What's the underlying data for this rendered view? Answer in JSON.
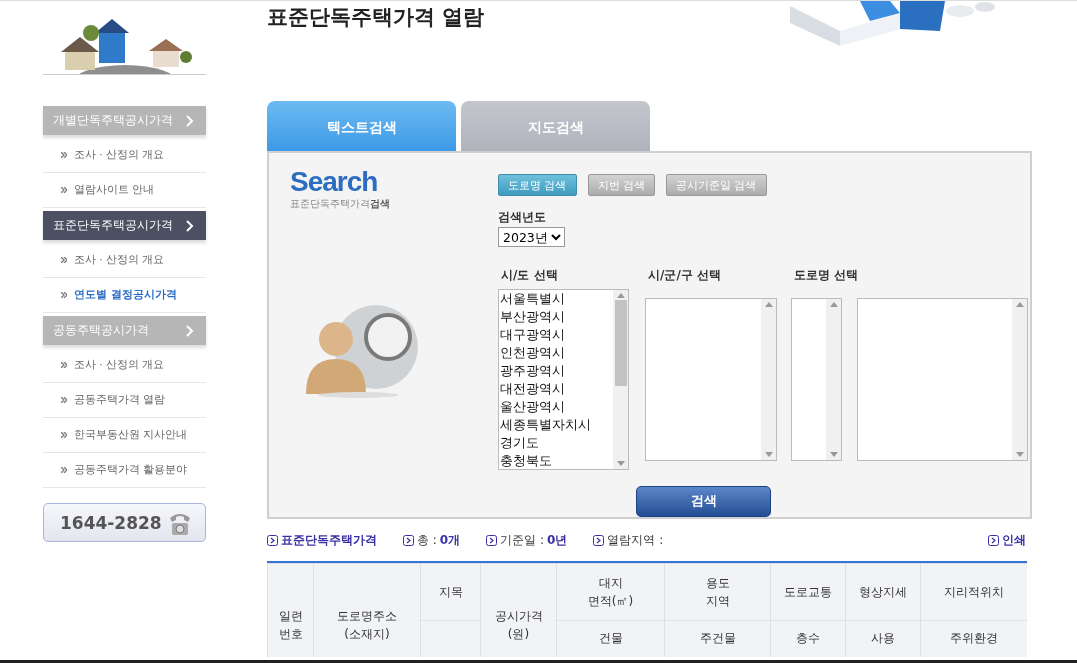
{
  "page_title": "표준단독주택가격 열람",
  "sidebar": {
    "sections": [
      {
        "title": "개별단독주택공시가격",
        "selected": false,
        "items": [
          {
            "label": "조사 · 산정의 개요",
            "selected": false
          },
          {
            "label": "열람사이트 안내",
            "selected": false
          }
        ]
      },
      {
        "title": "표준단독주택공시가격",
        "selected": true,
        "items": [
          {
            "label": "조사 · 산정의 개요",
            "selected": false
          },
          {
            "label": "연도별 결정공시가격",
            "selected": true
          }
        ]
      },
      {
        "title": "공동주택공시가격",
        "selected": false,
        "items": [
          {
            "label": "조사 · 산정의 개요",
            "selected": false
          },
          {
            "label": "공동주택가격 열람",
            "selected": false
          },
          {
            "label": "한국부동산원 지사안내",
            "selected": false
          },
          {
            "label": "공동주택가격 활용분야",
            "selected": false
          }
        ]
      }
    ],
    "phone": "1644-2828"
  },
  "tabs": [
    {
      "label": "텍스트검색",
      "selected": true
    },
    {
      "label": "지도검색",
      "selected": false
    }
  ],
  "search": {
    "logo": "Search",
    "logo_caption": "표준단독주택가격**검색**",
    "modes": [
      {
        "label": "도로명 검색",
        "selected": true
      },
      {
        "label": "지번 검색",
        "selected": false
      },
      {
        "label": "공시기준일 검색",
        "selected": false
      }
    ],
    "year_label": "검색년도",
    "year_value": "2023년",
    "lists": [
      {
        "label": "시/도 선택",
        "options": [
          "서울특별시",
          "부산광역시",
          "대구광역시",
          "인천광역시",
          "광주광역시",
          "대전광역시",
          "울산광역시",
          "세종특별자치시",
          "경기도",
          "충청북도"
        ]
      },
      {
        "label": "시/군/구 선택"
      },
      {
        "label": "도로명 선택"
      }
    ],
    "submit": "검색"
  },
  "summary": [
    {
      "label": "표준단독주택가격"
    },
    {
      "label": "총 :",
      "value": "0개"
    },
    {
      "label": "기준일 :",
      "value": "0년"
    },
    {
      "label": "열람지역 :"
    }
  ],
  "print": "인쇄",
  "table": {
    "header_rows": [
      [
        {
          "text": "일련\n번호",
          "spans_two_rows": true
        },
        {
          "text": "도로명주소\n(소재지)",
          "spans_two_rows": true
        },
        {
          "text": "지목",
          "spans_two_rows": false
        },
        {
          "text": "공시가격\n(원)",
          "spans_two_rows": true
        },
        {
          "text": "대지\n면적(㎡)",
          "spans_two_rows": false
        },
        {
          "text": "용도\n지역",
          "spans_two_rows": false
        },
        {
          "text": "도로교통",
          "spans_two_rows": false
        },
        {
          "text": "형상지세",
          "spans_two_rows": false
        },
        {
          "text": "지리적위치",
          "spans_two_rows": false
        }
      ],
      [
        {
          "spans_two_rows": false
        },
        {
          "text": "건물",
          "spans_two_rows": false
        },
        {
          "text": "주건물",
          "spans_two_rows": false
        },
        {
          "text": "층수",
          "spans_two_rows": false
        },
        {
          "text": "사용",
          "spans_two_rows": false
        },
        {
          "text": "주위환경",
          "spans_two_rows": false
        }
      ]
    ]
  }
}
